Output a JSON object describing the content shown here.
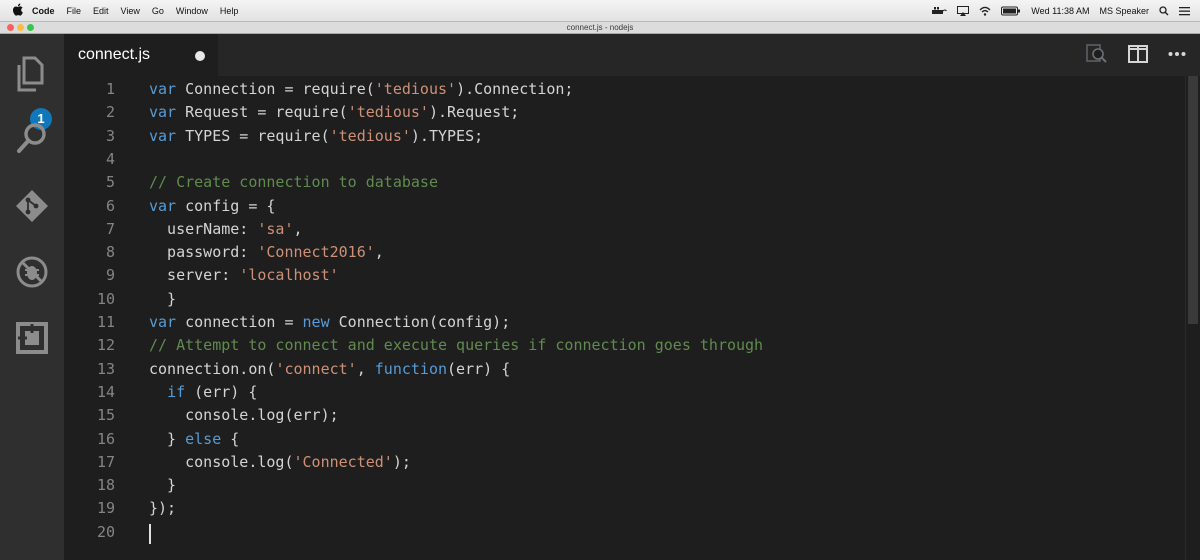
{
  "menubar": {
    "app_name": "Code",
    "items": [
      "File",
      "Edit",
      "View",
      "Go",
      "Window",
      "Help"
    ],
    "clock": "Wed 11:38 AM",
    "user": "MS Speaker"
  },
  "window": {
    "title": "connect.js - nodejs"
  },
  "activity_bar": {
    "icons": [
      "files-icon",
      "search-icon",
      "git-icon",
      "debug-icon",
      "extensions-icon"
    ],
    "badge": "1"
  },
  "tab": {
    "label": "connect.js",
    "dirty": true
  },
  "editor": {
    "lines": [
      {
        "num": "1",
        "text": "var Connection = require('tedious').Connection;"
      },
      {
        "num": "2",
        "text": "var Request = require('tedious').Request;"
      },
      {
        "num": "3",
        "text": "var TYPES = require('tedious').TYPES;"
      },
      {
        "num": "4",
        "text": ""
      },
      {
        "num": "5",
        "text": "// Create connection to database"
      },
      {
        "num": "6",
        "text": "var config = {"
      },
      {
        "num": "7",
        "text": "  userName: 'sa',"
      },
      {
        "num": "8",
        "text": "  password: 'Connect2016',"
      },
      {
        "num": "9",
        "text": "  server: 'localhost'"
      },
      {
        "num": "10",
        "text": "  }"
      },
      {
        "num": "11",
        "text": "var connection = new Connection(config);"
      },
      {
        "num": "12",
        "text": "// Attempt to connect and execute queries if connection goes through"
      },
      {
        "num": "13",
        "text": "connection.on('connect', function(err) {"
      },
      {
        "num": "14",
        "text": "  if (err) {"
      },
      {
        "num": "15",
        "text": "    console.log(err);"
      },
      {
        "num": "16",
        "text": "  } else {"
      },
      {
        "num": "17",
        "text": "    console.log('Connected');"
      },
      {
        "num": "18",
        "text": "  }"
      },
      {
        "num": "19",
        "text": "});"
      },
      {
        "num": "20",
        "text": ""
      }
    ]
  },
  "colors": {
    "editor_bg": "#1e1e1e",
    "activity_bg": "#2f2f2f",
    "keyword": "#569cd6",
    "string": "#ce9178",
    "comment": "#608b4e",
    "badge": "#1177bb"
  }
}
